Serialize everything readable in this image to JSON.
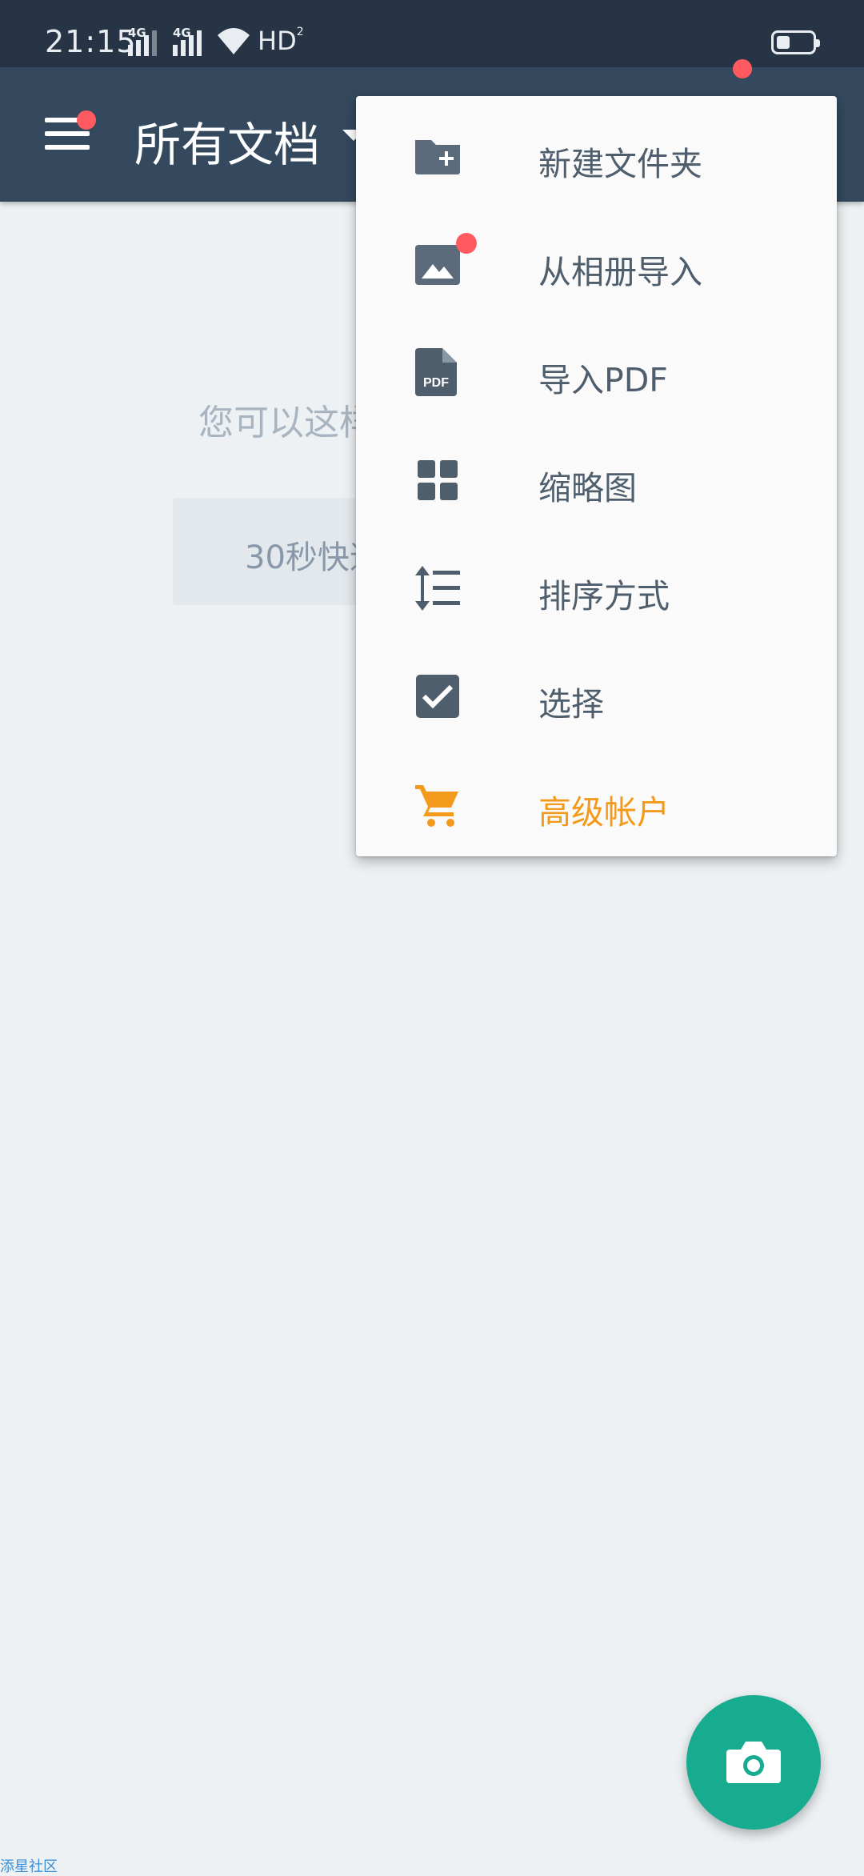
{
  "status_bar": {
    "time": "21:15",
    "network1": "4G",
    "network2": "4G",
    "hd_label": "HD",
    "hd_sub": "2"
  },
  "app_bar": {
    "title": "所有文档"
  },
  "content": {
    "empty_hint": "您可以这样",
    "tutorial_button": "30秒快速"
  },
  "dropdown_menu": {
    "items": [
      {
        "label": "新建文件夹",
        "icon": "folder-plus-icon"
      },
      {
        "label": "从相册导入",
        "icon": "image-icon"
      },
      {
        "label": "导入PDF",
        "icon": "pdf-file-icon",
        "icon_text": "PDF"
      },
      {
        "label": "缩略图",
        "icon": "grid-icon"
      },
      {
        "label": "排序方式",
        "icon": "sort-icon"
      },
      {
        "label": "选择",
        "icon": "checkbox-icon"
      },
      {
        "label": "高级帐户",
        "icon": "cart-icon"
      }
    ]
  },
  "fab": {
    "icon": "camera-icon"
  },
  "watermark": "添星社区",
  "colors": {
    "status_bar": "#263445",
    "app_bar": "#34495e",
    "background": "#edf1f3",
    "menu_text": "#4f5e6d",
    "premium": "#f39a1c",
    "fab": "#17ab8f",
    "notification_dot": "#ff5a5f"
  }
}
